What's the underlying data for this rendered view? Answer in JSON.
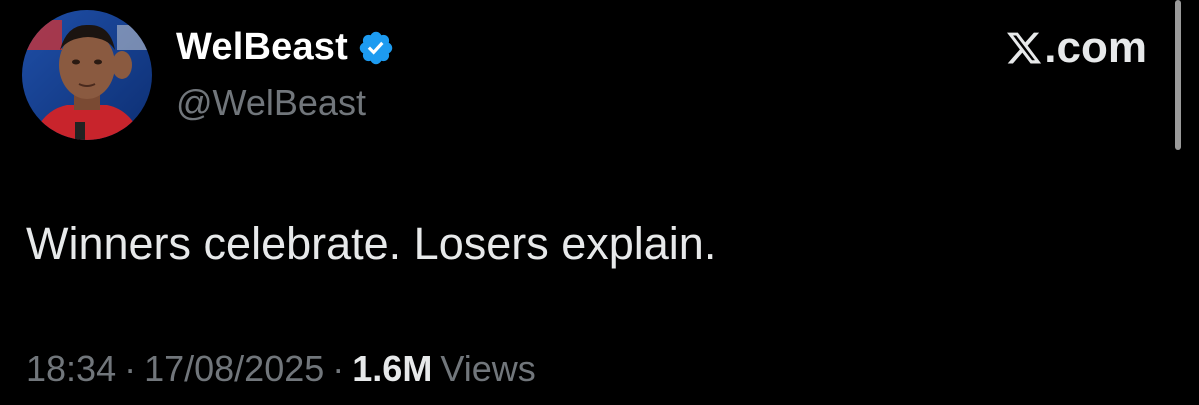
{
  "author": {
    "display_name": "WelBeast",
    "handle": "@WelBeast",
    "verified": true,
    "avatar_icon": "profile-photo",
    "verified_icon": "verified-badge-icon"
  },
  "brand": {
    "logo_icon": "x-logo-icon",
    "label": ".com"
  },
  "tweet": {
    "text": "Winners celebrate. Losers explain.",
    "time": "18:34",
    "date": "17/08/2025",
    "separator": "·",
    "views_count": "1.6M",
    "views_label": "Views"
  },
  "colors": {
    "background": "#000000",
    "primary_text": "#e7e9ea",
    "secondary_text": "#71767b",
    "verified_blue": "#1d9bf0"
  }
}
